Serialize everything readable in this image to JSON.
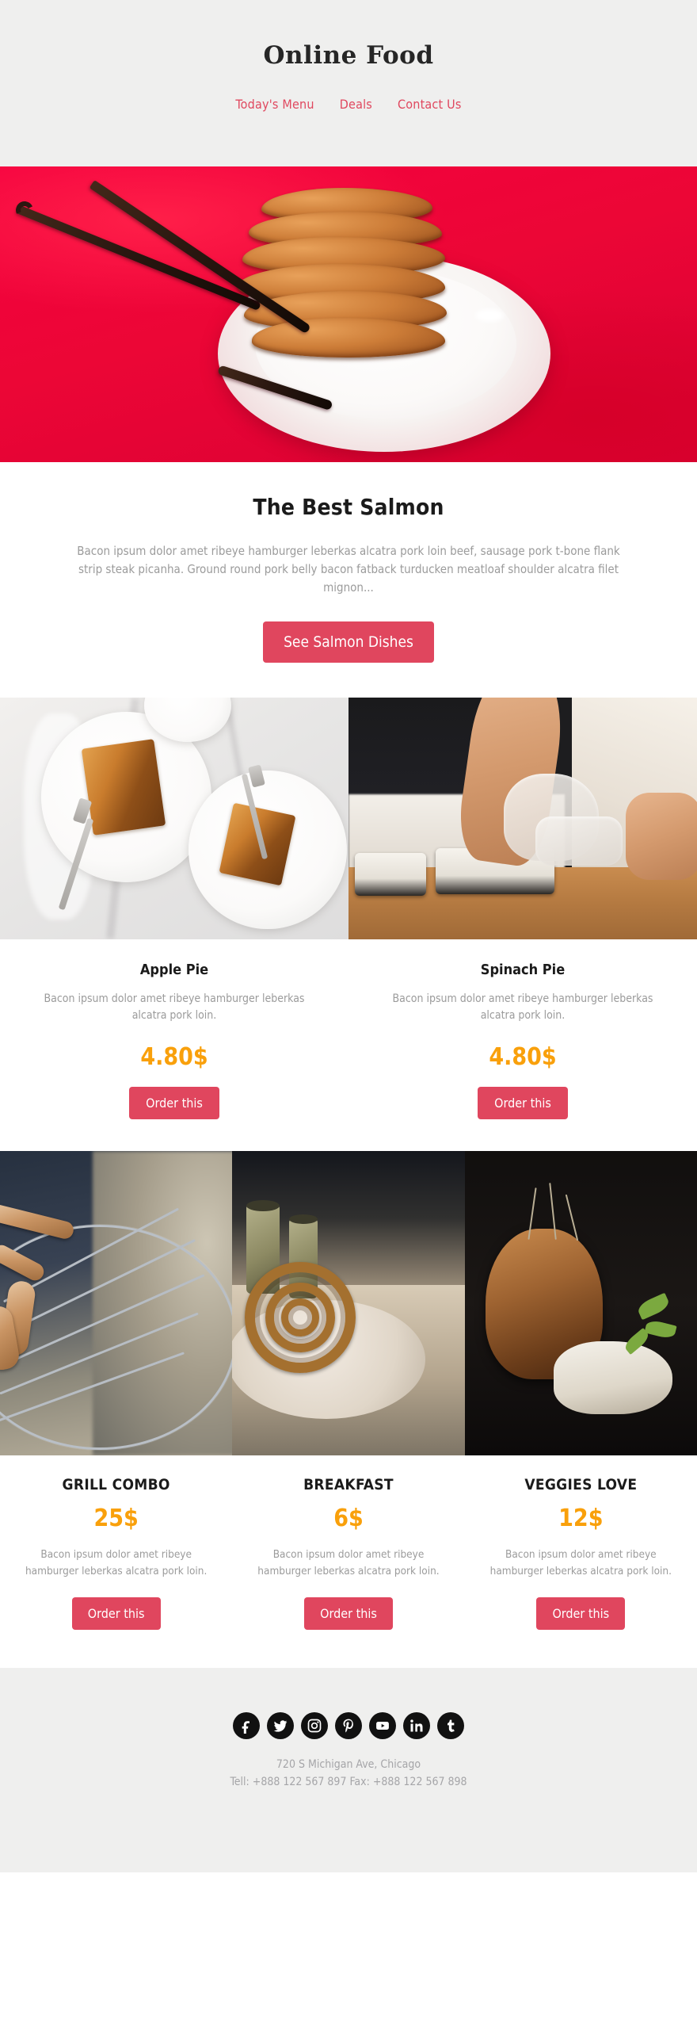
{
  "header": {
    "brand": "Online Food",
    "nav": [
      {
        "label": "Today's Menu",
        "name": "nav-todays-menu"
      },
      {
        "label": "Deals",
        "name": "nav-deals"
      },
      {
        "label": "Contact Us",
        "name": "nav-contact-us"
      }
    ]
  },
  "hero": {
    "alt": "Stack of cookies on a white plate with vanilla beans on a red tablecloth",
    "background_color": "#ed0b36"
  },
  "feature": {
    "title": "The Best Salmon",
    "body": "Bacon ipsum dolor amet ribeye hamburger leberkas alcatra pork loin beef, sausage pork t-bone flank strip steak picanha. Ground round pork belly bacon fatback turducken meatloaf shoulder alcatra filet mignon...",
    "cta": "See Salmon Dishes"
  },
  "pies": [
    {
      "image_alt": "Slices of apple pie on white plates with forks on marble",
      "title": "Apple Pie",
      "desc": "Bacon ipsum dolor amet ribeye hamburger leberkas alcatra pork loin.",
      "price": "4.80$",
      "cta": "Order this"
    },
    {
      "image_alt": "Chef hands in gloves rolling sushi on a wooden board",
      "title": "Spinach Pie",
      "desc": "Bacon ipsum dolor amet ribeye hamburger leberkas alcatra pork loin.",
      "price": "4.80$",
      "cta": "Order this"
    }
  ],
  "combos": [
    {
      "image_alt": "Sausages grilling on a round charcoal grill",
      "title": "GRILL COMBO",
      "price": "25$",
      "desc": "Bacon ipsum dolor amet ribeye hamburger leberkas alcatra pork loin.",
      "cta": "Order this"
    },
    {
      "image_alt": "Coiled sausage bread on a plate with two cups",
      "title": "BREAKFAST",
      "price": "6$",
      "desc": "Bacon ipsum dolor amet ribeye hamburger leberkas alcatra pork loin.",
      "cta": "Order this"
    },
    {
      "image_alt": "Roasted root vegetable on cream with green herbs",
      "title": "VEGGIES LOVE",
      "price": "12$",
      "desc": "Bacon ipsum dolor amet ribeye hamburger leberkas alcatra pork loin.",
      "cta": "Order this"
    }
  ],
  "footer": {
    "socials": [
      {
        "name": "facebook-icon",
        "label": "Facebook"
      },
      {
        "name": "twitter-icon",
        "label": "Twitter"
      },
      {
        "name": "instagram-icon",
        "label": "Instagram"
      },
      {
        "name": "pinterest-icon",
        "label": "Pinterest"
      },
      {
        "name": "youtube-icon",
        "label": "YouTube"
      },
      {
        "name": "linkedin-icon",
        "label": "LinkedIn"
      },
      {
        "name": "tumblr-icon",
        "label": "Tumblr"
      }
    ],
    "address": "720 S Michigan Ave, Chicago",
    "contact": "Tell: +888 122 567 897 Fax: +888 122 567 898"
  },
  "colors": {
    "accent_pink": "#e0465e",
    "price_orange": "#f9a00b",
    "panel_gray": "#efefee",
    "hero_red": "#ed0b36",
    "muted_text": "#9b9b9b"
  }
}
